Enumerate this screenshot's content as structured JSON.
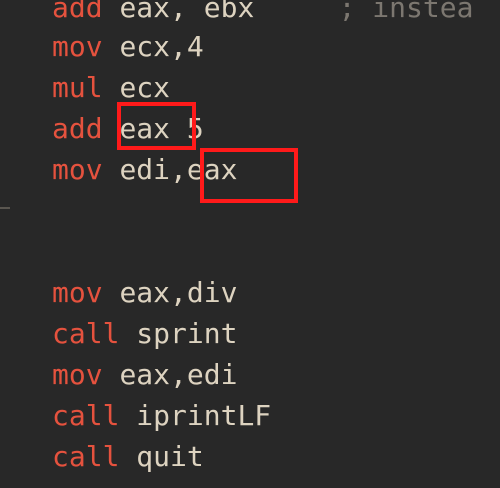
{
  "editor": {
    "lines": [
      {
        "keyword": "add",
        "operands": "eax, ebx",
        "comment": "; instea"
      },
      {
        "keyword": "mov",
        "operands": "ecx,4"
      },
      {
        "keyword": "mul",
        "operands": "ecx"
      },
      {
        "keyword": "add",
        "operands": "eax 5"
      },
      {
        "keyword": "mov",
        "operands": "edi,eax"
      },
      {
        "keyword": "mov",
        "operands": "eax,div"
      },
      {
        "keyword": "call",
        "operands": "sprint"
      },
      {
        "keyword": "mov",
        "operands": "eax,edi"
      },
      {
        "keyword": "call",
        "operands": "iprintLF"
      },
      {
        "keyword": "call",
        "operands": "quit"
      }
    ]
  },
  "colors": {
    "background": "#282828",
    "keyword": "#e5523e",
    "text": "#ddd3c0",
    "comment": "#7c7770",
    "highlight_box": "#ff1a1a"
  }
}
